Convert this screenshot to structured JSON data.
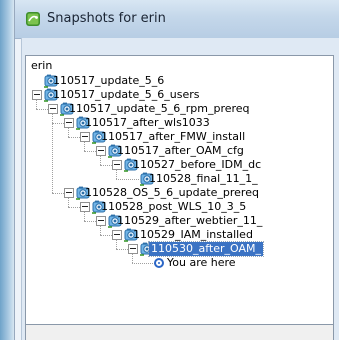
{
  "window": {
    "title": "Snapshots for erin"
  },
  "tree": {
    "root_label": "erin",
    "items": [
      {
        "label": "110517_update_5_6",
        "depth": 0,
        "toggle": false,
        "icon": "snapshot-icon"
      },
      {
        "label": "110517_update_5_6_users",
        "depth": 0,
        "toggle": true,
        "icon": "snapshot-icon"
      },
      {
        "label": "110517_update_5_6_rpm_prereq",
        "depth": 1,
        "toggle": true,
        "icon": "snapshot-icon"
      },
      {
        "label": "110517_after_wls1033",
        "depth": 2,
        "toggle": true,
        "icon": "snapshot-icon"
      },
      {
        "label": "110517_after_FMW_install",
        "depth": 3,
        "toggle": true,
        "icon": "snapshot-icon"
      },
      {
        "label": "110517_after_OAM_cfg",
        "depth": 4,
        "toggle": true,
        "icon": "snapshot-icon"
      },
      {
        "label": "110527_before_IDM_dc",
        "depth": 5,
        "toggle": true,
        "icon": "snapshot-icon"
      },
      {
        "label": "110528_final_11_1_",
        "depth": 6,
        "toggle": false,
        "icon": "snapshot-icon"
      },
      {
        "label": "110528_OS_5_6_update_prereq",
        "depth": 2,
        "toggle": true,
        "icon": "snapshot-icon"
      },
      {
        "label": "110528_post_WLS_10_3_5",
        "depth": 3,
        "toggle": true,
        "icon": "snapshot-icon"
      },
      {
        "label": "110529_after_webtier_11_",
        "depth": 4,
        "toggle": true,
        "icon": "snapshot-icon"
      },
      {
        "label": "110529_IAM_installed",
        "depth": 5,
        "toggle": true,
        "icon": "snapshot-icon"
      },
      {
        "label": "110530_after_OAM_",
        "depth": 6,
        "toggle": true,
        "icon": "snapshot-icon",
        "selected": true
      },
      {
        "label": "You are here",
        "depth": 7,
        "toggle": false,
        "icon": "you-are-here-icon"
      }
    ]
  },
  "colors": {
    "selection": "#3b73c4",
    "titlebar": "#c4d7ea"
  }
}
